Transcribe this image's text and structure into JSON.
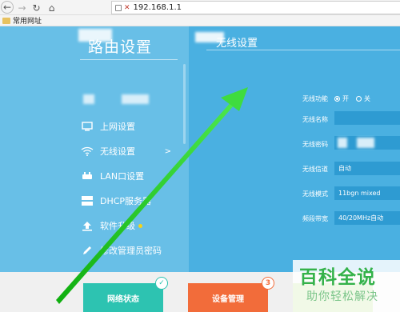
{
  "browser": {
    "url": "192.168.1.1",
    "bookmark_folder": "常用网址"
  },
  "sidebar": {
    "title": "路由设置",
    "items": [
      {
        "label": "上网设置",
        "icon": "monitor-icon"
      },
      {
        "label": "无线设置",
        "icon": "wifi-icon",
        "chevron": ">"
      },
      {
        "label": "LAN口设置",
        "icon": "router-icon"
      },
      {
        "label": "DHCP服务器",
        "icon": "dhcp-icon"
      },
      {
        "label": "软件升级",
        "icon": "upload-icon"
      },
      {
        "label": "修改管理员密码",
        "icon": "pencil-icon"
      }
    ]
  },
  "main": {
    "title": "无线设置",
    "fields": {
      "wireless_func": {
        "label": "无线功能",
        "on": "开",
        "off": "关",
        "selected": "on"
      },
      "ssid": {
        "label": "无线名称",
        "value": ""
      },
      "password": {
        "label": "无线密码",
        "value": ""
      },
      "channel": {
        "label": "无线信道",
        "value": "自动"
      },
      "mode": {
        "label": "无线模式",
        "value": "11bgn mixed"
      },
      "bandwidth": {
        "label": "频段带宽",
        "value": "40/20MHz自动"
      }
    }
  },
  "bottom": {
    "tiles": [
      {
        "label": "网络状态",
        "color": "#2dc3b1"
      },
      {
        "label": "设备管理",
        "color": "#f26c3a",
        "badge": "3"
      }
    ]
  },
  "watermark": {
    "main": "百科全说",
    "sub": "助你轻松解决"
  },
  "colors": {
    "sidebar_bg": "#68bfe7",
    "main_bg": "#4ab0e1",
    "input_bg": "#2e9bd2",
    "arrow_green": "#2ed12e"
  }
}
